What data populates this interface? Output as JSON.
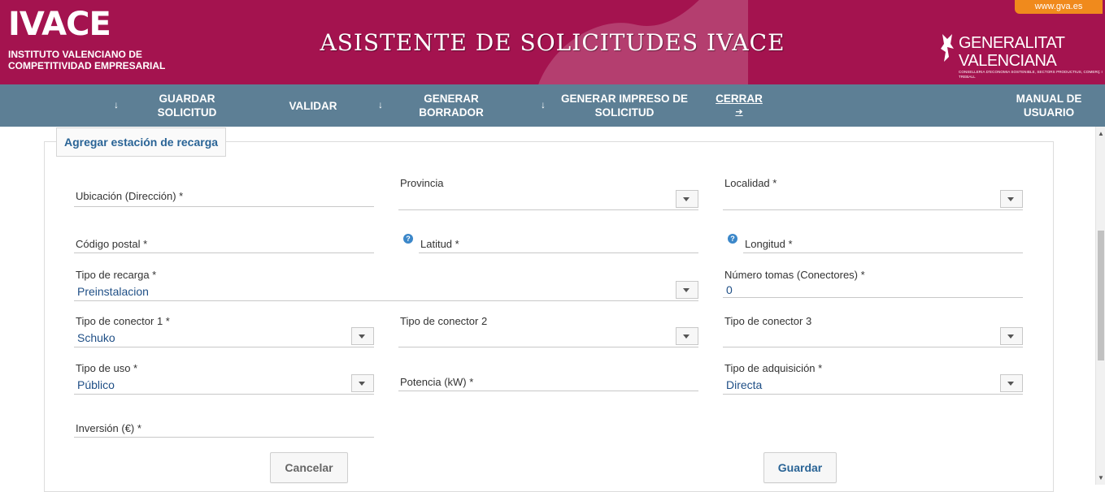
{
  "header": {
    "logo_main": "IVACE",
    "logo_line1": "INSTITUTO VALENCIANO DE",
    "logo_line2": "COMPETITIVIDAD EMPRESARIAL",
    "title": "ASISTENTE DE SOLICITUDES IVACE",
    "gva_link": "www.gva.es",
    "gva_name": "GENERALITAT VALENCIANA",
    "gva_sub": "CONSELLERIA D'ECONOMIA SOSTENIBLE, SECTORS PRODUCTIUS, COMERÇ I TREBALL"
  },
  "nav": {
    "guardar_line1": "GUARDAR",
    "guardar_line2": "SOLICITUD",
    "validar": "VALIDAR",
    "borrador_line1": "GENERAR",
    "borrador_line2": "BORRADOR",
    "impreso_line1": "GENERAR IMPRESO DE",
    "impreso_line2": "SOLICITUD",
    "cerrar": "CERRAR",
    "manual_line1": "MANUAL DE",
    "manual_line2": "USUARIO",
    "arrow_glyph": "↓",
    "exit_glyph": "➔"
  },
  "panel": {
    "tab_label": "Agregar estación de recarga"
  },
  "form": {
    "ubicacion": {
      "label": "Ubicación (Dirección) *",
      "value": ""
    },
    "provincia": {
      "label": "Provincia",
      "value": ""
    },
    "localidad": {
      "label": "Localidad *",
      "value": ""
    },
    "codigo_postal": {
      "label": "Código postal *",
      "value": ""
    },
    "latitud": {
      "label": "Latitud *",
      "value": ""
    },
    "longitud": {
      "label": "Longitud *",
      "value": ""
    },
    "tipo_recarga": {
      "label": "Tipo de recarga *",
      "value": "Preinstalacion"
    },
    "numero_tomas": {
      "label": "Número tomas (Conectores) *",
      "value": "0"
    },
    "conector1": {
      "label": "Tipo de conector 1 *",
      "value": "Schuko"
    },
    "conector2": {
      "label": "Tipo de conector 2",
      "value": ""
    },
    "conector3": {
      "label": "Tipo de conector 3",
      "value": ""
    },
    "tipo_uso": {
      "label": "Tipo de uso *",
      "value": "Público"
    },
    "potencia": {
      "label": "Potencia (kW) *",
      "value": ""
    },
    "tipo_adquisicion": {
      "label": "Tipo de adquisición *",
      "value": "Directa"
    },
    "inversion": {
      "label": "Inversión (€) *",
      "value": ""
    },
    "help_glyph": "?"
  },
  "buttons": {
    "cancel": "Cancelar",
    "save": "Guardar"
  },
  "colors": {
    "header_bg": "#a4134f",
    "nav_bg": "#5d7f95",
    "gva_tab": "#f08a1c",
    "value_text": "#1f4f86",
    "link_blue": "#2a6496"
  }
}
